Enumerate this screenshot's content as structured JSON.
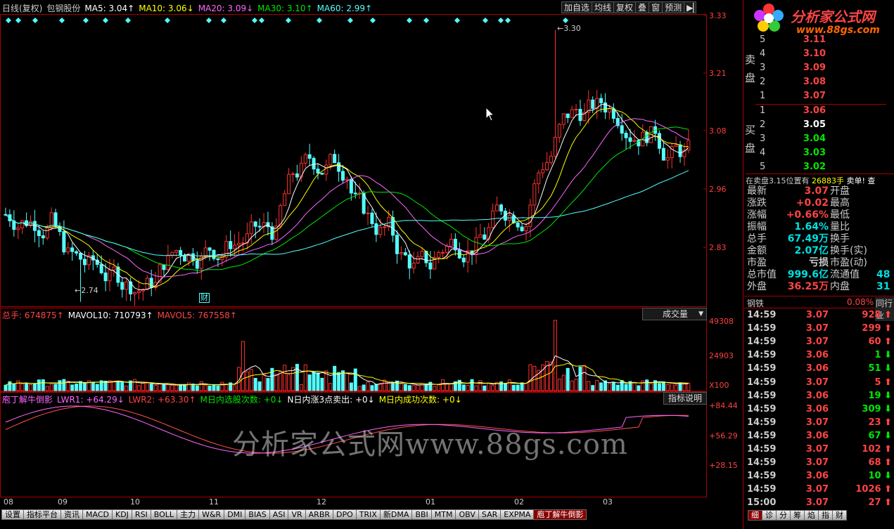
{
  "header": {
    "ma_items": [
      {
        "text": "日线(复权)",
        "color": "#cccccc"
      },
      {
        "text": "包钢股份",
        "color": "#cccccc"
      },
      {
        "text": "MA5: 3.04↑",
        "color": "#ffffff"
      },
      {
        "text": "MA10: 3.06↓",
        "color": "#ffff00"
      },
      {
        "text": "MA20: 3.09↓",
        "color": "#ff66ff"
      },
      {
        "text": "MA30: 3.10↑",
        "color": "#00e600"
      },
      {
        "text": "MA60: 2.99↑",
        "color": "#54ffff"
      }
    ],
    "buttons": [
      "加自选",
      "均线",
      "复权",
      "叠",
      "窗",
      "预测"
    ],
    "play_icon": "play-icon"
  },
  "price_axis": [
    "3.33",
    "3.21",
    "3.08",
    "2.96",
    "2.83"
  ],
  "annotations": {
    "high": "3.30",
    "low": "2.74",
    "finance": "财"
  },
  "volume_panel": {
    "items": [
      {
        "text": "总手: 674875↑",
        "color": "#ff4444"
      },
      {
        "text": "MAVOL10: 710793↑",
        "color": "#ffffff"
      },
      {
        "text": "MAVOL5: 767558↑",
        "color": "#ff4444"
      }
    ],
    "dropdown": "成交量",
    "axis": [
      "49308",
      "24903",
      "X100"
    ]
  },
  "indicator_panel": {
    "items": [
      {
        "text": "庖丁解牛倒影",
        "color": "#ff66ff"
      },
      {
        "text": "LWR1: +64.29↓",
        "color": "#ff66ff"
      },
      {
        "text": "LWR2: +63.30↑",
        "color": "#ff4444"
      },
      {
        "text": "M日内选股次数: +0↓",
        "color": "#00e600"
      },
      {
        "text": "N日内涨3点卖出: +0↓",
        "color": "#ffffff"
      },
      {
        "text": "M日内成功次数: +0↓",
        "color": "#ffff00"
      }
    ],
    "help_button": "指标说明",
    "axis": [
      "+84.44",
      "+56.29",
      "+28.15"
    ]
  },
  "watermark": "分析家公式网www.88gs.com",
  "logo": {
    "name": "分析家公式网",
    "url": "www.88gs.com"
  },
  "x_axis": [
    "08",
    "09",
    "10",
    "11",
    "12",
    "01",
    "02",
    "03"
  ],
  "bottom_tabs": [
    "设置",
    "指标平台",
    "资讯",
    "MACD",
    "KDJ",
    "RSI",
    "BOLL",
    "主力",
    "W&R",
    "DMI",
    "BIAS",
    "ASI",
    "VR",
    "ARBR",
    "DPO",
    "TRIX",
    "新DMA",
    "BBI",
    "MTM",
    "OBV",
    "SAR",
    "EXPMA",
    "庖丁解牛倒影"
  ],
  "right_panel": {
    "sell_label": [
      "卖",
      "盘"
    ],
    "buy_label": [
      "买",
      "盘"
    ],
    "sell": [
      {
        "n": "5",
        "p": "3.11"
      },
      {
        "n": "4",
        "p": "3.10"
      },
      {
        "n": "3",
        "p": "3.09"
      },
      {
        "n": "2",
        "p": "3.08"
      },
      {
        "n": "1",
        "p": "3.07"
      }
    ],
    "buy": [
      {
        "n": "1",
        "p": "3.06"
      },
      {
        "n": "2",
        "p": "3.05"
      },
      {
        "n": "3",
        "p": "3.04"
      },
      {
        "n": "4",
        "p": "3.03"
      },
      {
        "n": "5",
        "p": "3.02"
      }
    ],
    "order_line": [
      "在卖盘3.15位置有",
      "26883手",
      "卖单!",
      "查"
    ],
    "stats": [
      {
        "l": "最新",
        "v": "3.07",
        "l2": "开盘",
        "v2": ""
      },
      {
        "l": "涨跌",
        "v": "+0.02",
        "l2": "最高",
        "v2": ""
      },
      {
        "l": "涨幅",
        "v": "+0.66%",
        "l2": "最低",
        "v2": ""
      },
      {
        "l": "振幅",
        "v": "1.64%",
        "l2": "量比",
        "v2": ""
      },
      {
        "l": "总手",
        "v": "67.49万",
        "l2": "换手",
        "v2": ""
      },
      {
        "l": "金额",
        "v": "2.07亿",
        "l2": "换手(实)",
        "v2": ""
      },
      {
        "l": "市盈",
        "v": "亏损",
        "l2": "市盈(动)",
        "v2": ""
      },
      {
        "l": "总市值",
        "v": "999.6亿",
        "l2": "流通值",
        "v2": "48"
      },
      {
        "l": "外盘",
        "v": "36.25万",
        "l2": "内盘",
        "v2": "31"
      }
    ],
    "industry": {
      "name": "钢铁",
      "pct": "0.08%",
      "btn": "同行业"
    },
    "ticks": [
      {
        "t": "14:59",
        "p": "3.07",
        "v": "928",
        "d": "up"
      },
      {
        "t": "14:59",
        "p": "3.07",
        "v": "299",
        "d": "up"
      },
      {
        "t": "14:59",
        "p": "3.07",
        "v": "60",
        "d": "up"
      },
      {
        "t": "14:59",
        "p": "3.06",
        "v": "1",
        "d": "down"
      },
      {
        "t": "14:59",
        "p": "3.06",
        "v": "51",
        "d": "down"
      },
      {
        "t": "14:59",
        "p": "3.07",
        "v": "5",
        "d": "up"
      },
      {
        "t": "14:59",
        "p": "3.06",
        "v": "19",
        "d": "down"
      },
      {
        "t": "14:59",
        "p": "3.06",
        "v": "309",
        "d": "down"
      },
      {
        "t": "14:59",
        "p": "3.07",
        "v": "23",
        "d": "up"
      },
      {
        "t": "14:59",
        "p": "3.06",
        "v": "67",
        "d": "down"
      },
      {
        "t": "14:59",
        "p": "3.07",
        "v": "102",
        "d": "up"
      },
      {
        "t": "14:59",
        "p": "3.07",
        "v": "68",
        "d": "up"
      },
      {
        "t": "14:59",
        "p": "3.06",
        "v": "10",
        "d": "down"
      },
      {
        "t": "14:59",
        "p": "3.07",
        "v": "1026",
        "d": "up"
      },
      {
        "t": "15:00",
        "p": "3.07",
        "v": "27",
        "d": "up"
      }
    ],
    "bottom_tabs": [
      "细",
      "诊",
      "分",
      "筹",
      "焰",
      "指",
      "财"
    ]
  }
}
